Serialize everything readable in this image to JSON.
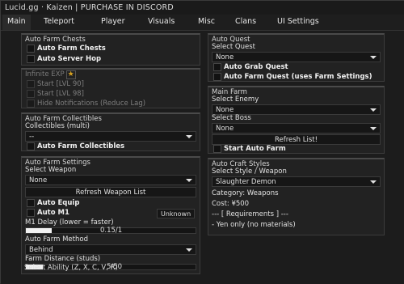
{
  "window": {
    "title": "Lucid.gg · Kaizen | PURCHASE IN DISCORD"
  },
  "tabs": [
    "Main",
    "Teleport",
    "Player",
    "Visuals",
    "Misc",
    "Clans",
    "UI Settings"
  ],
  "active_tab": "Main",
  "left": {
    "auto_farm_chests": {
      "title": "Auto Farm Chests",
      "auto_farm_chests": "Auto Farm Chests",
      "auto_server_hop": "Auto Server Hop"
    },
    "infinite_exp": {
      "title": "Infinite EXP",
      "star_icon": "star-icon",
      "start_lvl90": "Start [LVL 90]",
      "start_lvl98": "Start [LVL 98]",
      "hide_notifications": "Hide Notifications (Reduce Lag)"
    },
    "collectibles": {
      "title": "Auto Farm Collectibles",
      "label": "Collectibles (multi)",
      "value": "--",
      "auto_farm_collectibles": "Auto Farm Collectibles"
    },
    "settings": {
      "title": "Auto Farm Settings",
      "select_weapon_label": "Select Weapon",
      "select_weapon_value": "None",
      "refresh_weapon_list": "Refresh Weapon List",
      "auto_equip": "Auto Equip",
      "auto_m1": "Auto M1",
      "m1_keybind": "Unknown",
      "m1_delay_label": "M1 Delay (lower = faster)",
      "m1_delay_value": "0.15/1",
      "m1_delay_fraction": 0.15,
      "method_label": "Auto Farm Method",
      "method_value": "Behind",
      "distance_label": "Farm Distance (studs)",
      "distance_value": "5/50",
      "distance_fraction": 0.1,
      "ability_label": "Select Ability (Z, X, C, V, R)"
    }
  },
  "right": {
    "auto_quest": {
      "title": "Auto Quest",
      "select_quest_label": "Select Quest",
      "select_quest_value": "None",
      "auto_grab_quest": "Auto Grab Quest",
      "auto_farm_quest": "Auto Farm Quest (uses Farm Settings)"
    },
    "main_farm": {
      "title": "Main Farm",
      "select_enemy_label": "Select Enemy",
      "select_enemy_value": "None",
      "select_boss_label": "Select Boss",
      "select_boss_value": "None",
      "refresh_list": "Refresh List!",
      "start_auto_farm": "Start Auto Farm"
    },
    "craft": {
      "title": "Auto Craft Styles",
      "select_label": "Select Style / Weapon",
      "select_value": "Slaughter Demon",
      "category": "Category: Weapons",
      "cost": "Cost: ¥500",
      "requirements": "--- [ Requirements ] ---",
      "yen_only": "- Yen only (no materials)"
    }
  }
}
